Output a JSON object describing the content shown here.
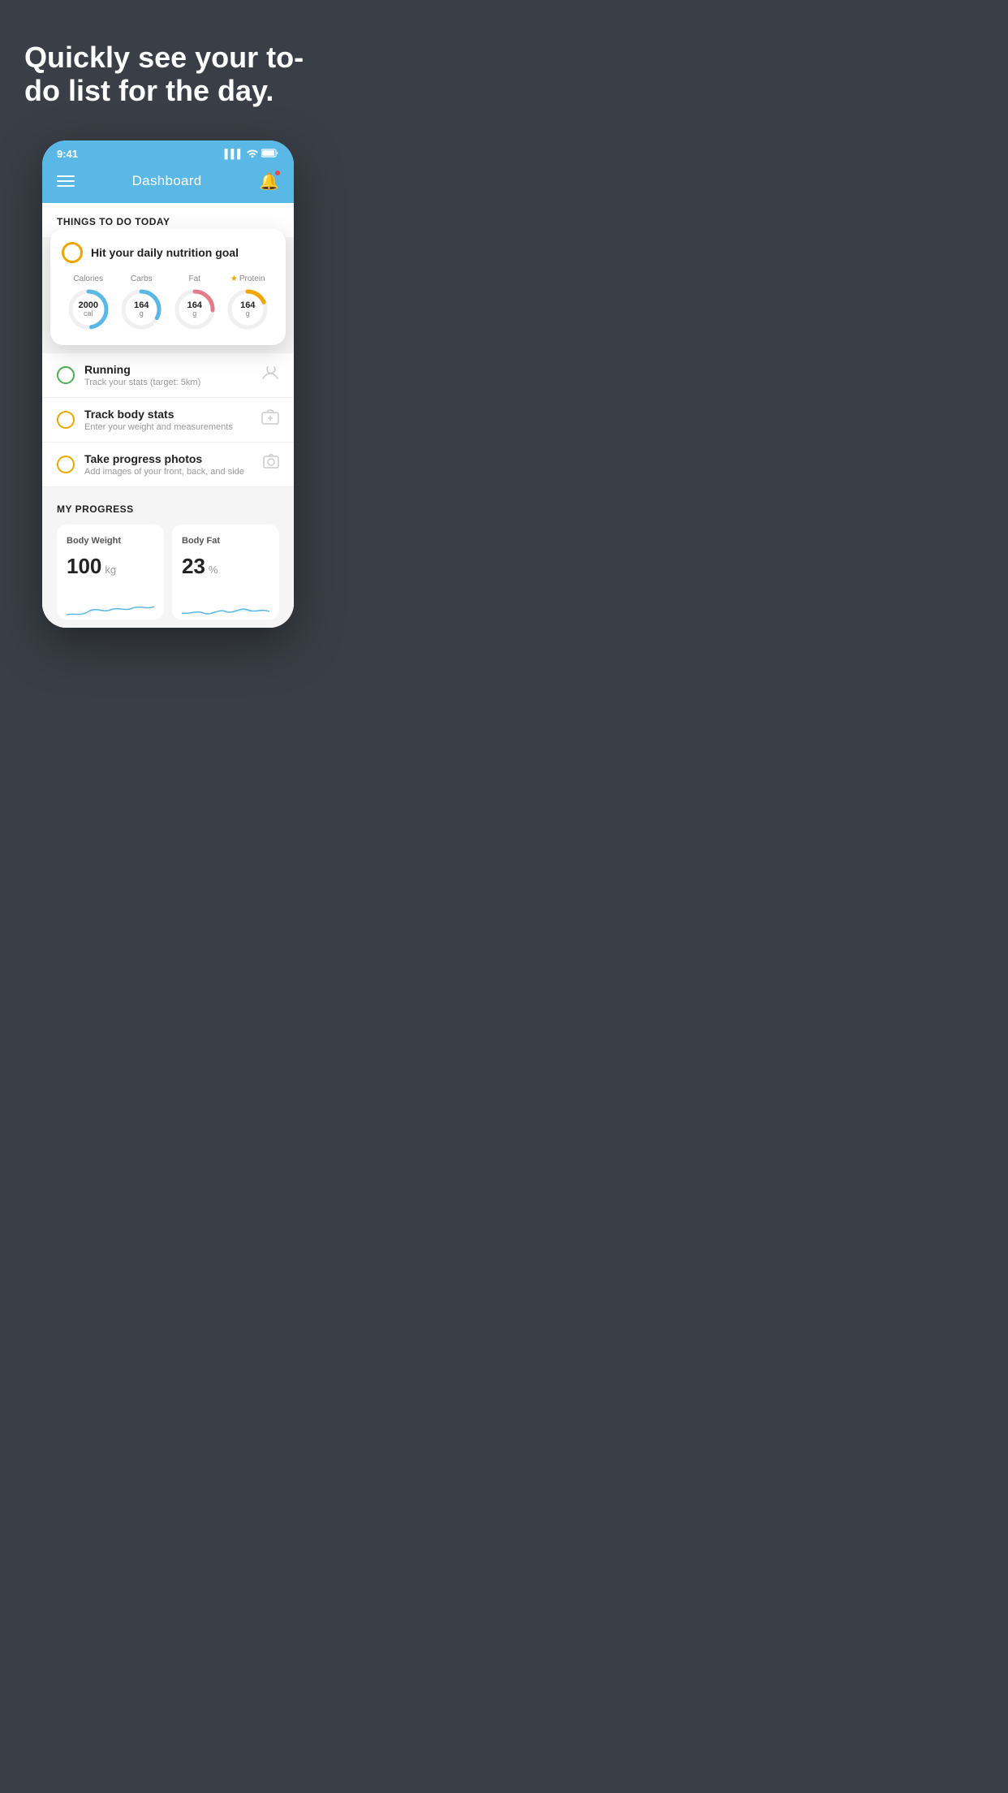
{
  "hero": {
    "title": "Quickly see your to-do list for the day."
  },
  "statusBar": {
    "time": "9:41",
    "signal": "▌▌▌",
    "wifi": "wifi",
    "battery": "battery"
  },
  "nav": {
    "title": "Dashboard"
  },
  "thingsToDay": {
    "sectionTitle": "THINGS TO DO TODAY"
  },
  "nutritionCard": {
    "checkLabel": "",
    "title": "Hit your daily nutrition goal",
    "items": [
      {
        "label": "Calories",
        "value": "2000",
        "unit": "cal",
        "type": "blue",
        "star": false
      },
      {
        "label": "Carbs",
        "value": "164",
        "unit": "g",
        "type": "blue",
        "star": false
      },
      {
        "label": "Fat",
        "value": "164",
        "unit": "g",
        "type": "pink",
        "star": false
      },
      {
        "label": "Protein",
        "value": "164",
        "unit": "g",
        "type": "yellow",
        "star": true
      }
    ]
  },
  "todoItems": [
    {
      "id": "running",
      "title": "Running",
      "subtitle": "Track your stats (target: 5km)",
      "checkColor": "green",
      "icon": "👟"
    },
    {
      "id": "body-stats",
      "title": "Track body stats",
      "subtitle": "Enter your weight and measurements",
      "checkColor": "yellow",
      "icon": "⚖️"
    },
    {
      "id": "progress-photos",
      "title": "Take progress photos",
      "subtitle": "Add images of your front, back, and side",
      "checkColor": "yellow",
      "icon": "🖼️"
    }
  ],
  "progressSection": {
    "title": "MY PROGRESS",
    "cards": [
      {
        "title": "Body Weight",
        "value": "100",
        "unit": "kg"
      },
      {
        "title": "Body Fat",
        "value": "23",
        "unit": "%"
      }
    ]
  }
}
